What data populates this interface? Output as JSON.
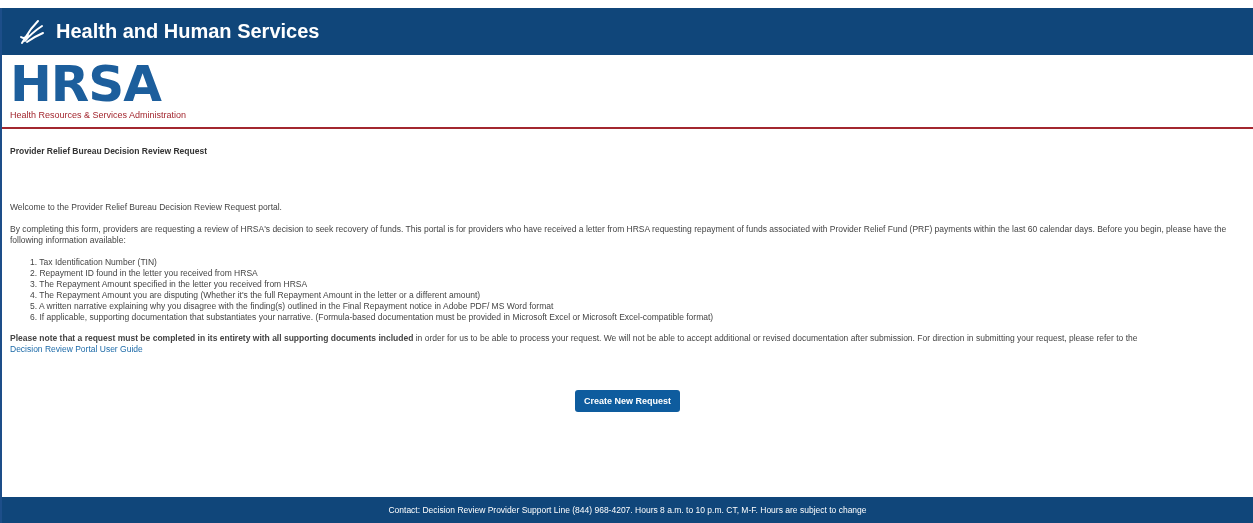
{
  "header": {
    "title": "Health and Human Services"
  },
  "logo": {
    "wordmark": "HRSA",
    "subtitle": "Health Resources & Services Administration"
  },
  "page_title": "Provider Relief Bureau Decision Review Request",
  "welcome": "Welcome to the Provider Relief Bureau Decision Review Request portal.",
  "intro": "By completing this form, providers are requesting a review of HRSA's decision to seek recovery of funds. This portal is for providers who have received a letter from HRSA requesting repayment of funds associated with Provider Relief Fund (PRF) payments within the last 60 calendar days. Before you begin, please have the following information available:",
  "requirements": [
    "1. Tax Identification Number (TIN)",
    "2. Repayment ID found in the letter you received from HRSA",
    "3. The Repayment Amount specified in the letter you received from HRSA",
    "4. The Repayment Amount you are disputing (Whether it's the full Repayment Amount in the letter or a different amount)",
    "5. A written narrative explaining why you disagree with the finding(s) outlined in the Final Repayment notice in Adobe PDF/ MS Word format",
    "6. If applicable, supporting documentation that substantiates your narrative. (Formula-based documentation must be provided in Microsoft Excel or Microsoft Excel-compatible format)"
  ],
  "note": {
    "text": "**Please note that a request must be completed in its entirety with all supporting documents included** in order for us to be able to process your request. We will not be able to accept additional or revised documentation after submission. For direction in submitting your request, please refer to the",
    "link": "Decision Review Portal User Guide"
  },
  "button": "Create New Request",
  "footer": "Contact: Decision Review Provider Support Line (844) 968-4207. Hours 8 a.m. to 10 p.m. CT, M-F. Hours are subject to change"
}
